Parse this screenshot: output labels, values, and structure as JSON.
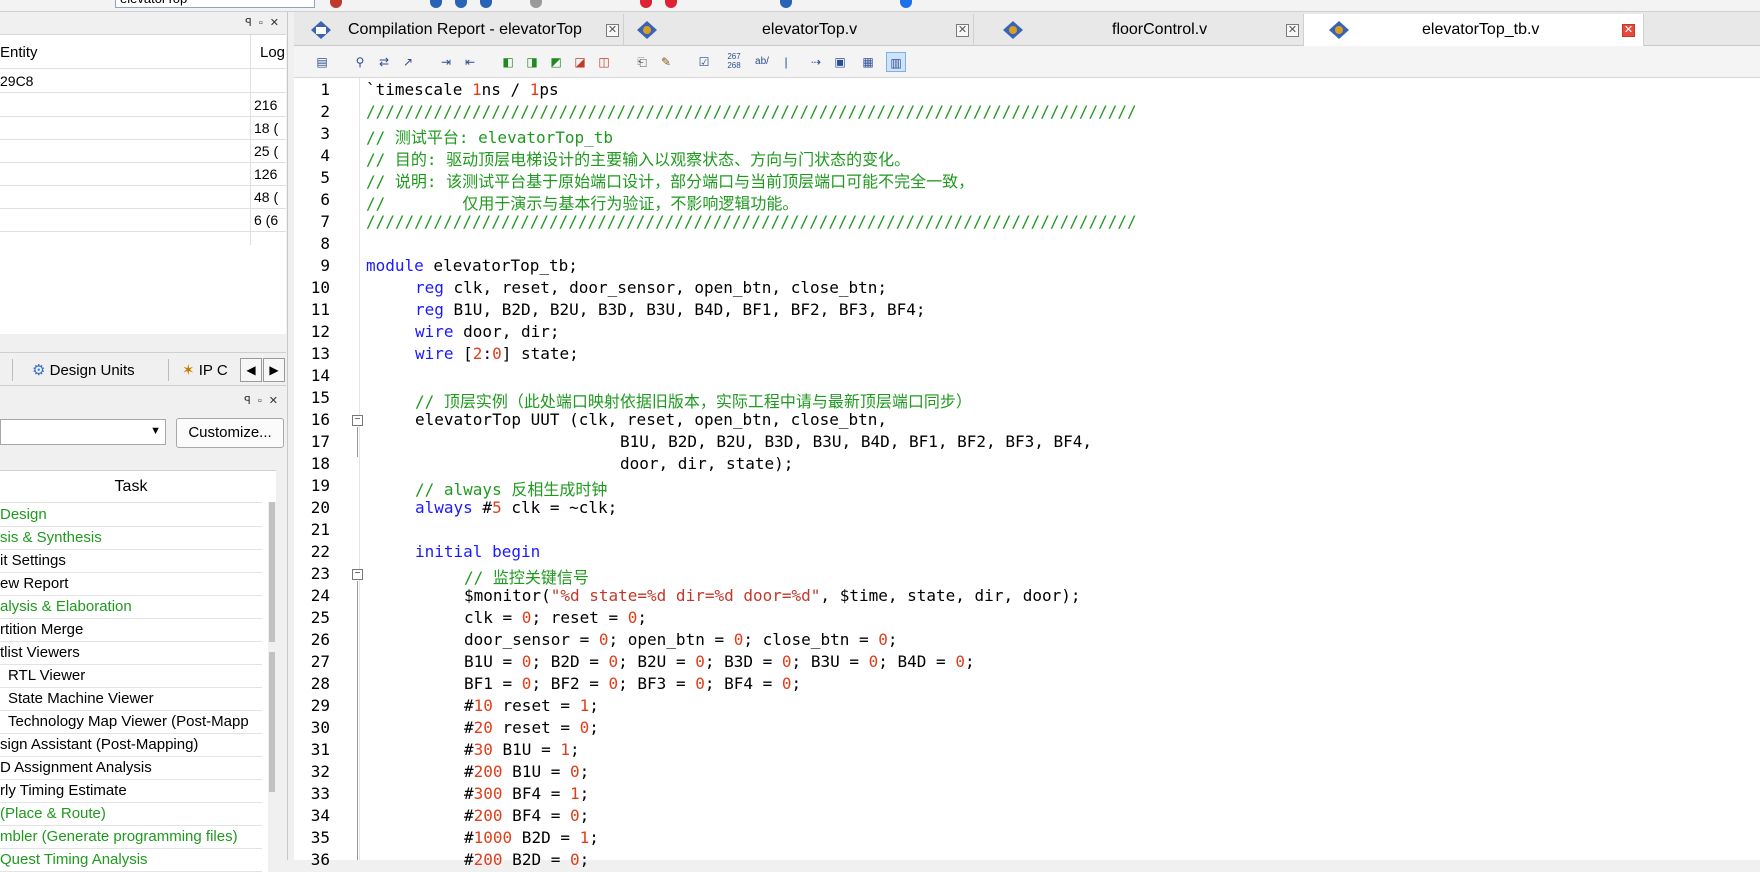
{
  "toolbar": {
    "search_value": "elevatorTop"
  },
  "entity_panel": {
    "col_entity": "Entity",
    "col_logic": "Log",
    "device": "29C8",
    "rows": [
      "216",
      "18 (",
      "25 (",
      "126",
      "48 (",
      "6 (6"
    ]
  },
  "left_tabs": {
    "design_units": "Design Units",
    "ip": "IP C"
  },
  "tasks": {
    "customize_label": "Customize...",
    "header": "Task",
    "items": [
      "Design",
      "sis & Synthesis",
      "it Settings",
      "ew Report",
      "alysis & Elaboration",
      "rtition Merge",
      "tlist Viewers",
      "RTL Viewer",
      "State Machine Viewer",
      "Technology Map Viewer (Post-Mapp",
      "sign Assistant (Post-Mapping)",
      "D Assignment Analysis",
      "rly Timing Estimate",
      "(Place & Route)",
      "mbler (Generate programming files)",
      "Quest Timing Analysis"
    ]
  },
  "tabs": [
    {
      "label": "Compilation Report - elevatorTop"
    },
    {
      "label": "elevatorTop.v"
    },
    {
      "label": "floorControl.v"
    },
    {
      "label": "elevatorTop_tb.v"
    }
  ],
  "editor_toolbar": {
    "line_counter": "267\n268",
    "ab_label": "ab/"
  },
  "colors": {
    "keyword": "#1a1aff",
    "number": "#e03e1a",
    "comment": "#1f9a1f",
    "tab_close_active": "#e64a3b"
  },
  "code": {
    "l1a": "`timescale ",
    "l1b": "1",
    "l1c": "ns / ",
    "l1d": "1",
    "l1e": "ps",
    "l2": "////////////////////////////////////////////////////////////////////////////////",
    "l3": "// 测试平台: elevatorTop_tb",
    "l4": "// 目的: 驱动顶层电梯设计的主要输入以观察状态、方向与门状态的变化。",
    "l5": "// 说明: 该测试平台基于原始端口设计，部分端口与当前顶层端口可能不完全一致，",
    "l6": "//        仅用于演示与基本行为验证，不影响逻辑功能。",
    "l7": "////////////////////////////////////////////////////////////////////////////////",
    "l9a": "module",
    "l9b": " elevatorTop_tb;",
    "l10a": "reg",
    "l10b": " clk, reset, door_sensor, open_btn, close_btn;",
    "l11a": "reg",
    "l11b": " B1U, B2D, B2U, B3D, B3U, B4D, BF1, BF2, BF3, BF4;",
    "l12a": "wire",
    "l12b": " door, dir;",
    "l13a": "wire",
    "l13b": " [",
    "l13c": "2",
    "l13d": ":",
    "l13e": "0",
    "l13f": "] state;",
    "l15": "// 顶层实例（此处端口映射依据旧版本，实际工程中请与最新顶层端口同步）",
    "l16": "elevatorTop UUT (clk, reset, open_btn, close_btn,",
    "l17": "B1U, B2D, B2U, B3D, B3U, B4D, BF1, BF2, BF3, BF4,",
    "l18": "door, dir, state);",
    "l19": "// always 反相生成时钟",
    "l20a": "always",
    "l20b": " #",
    "l20c": "5",
    "l20d": " clk = ~clk;",
    "l22a": "initial",
    "l22b": " ",
    "l22c": "begin",
    "l23": "// 监控关键信号",
    "l24a": "$monitor(",
    "l24b": "\"%d state=%d dir=%d door=%d\"",
    "l24c": ", $time, state, dir, door);",
    "l25a": "clk = ",
    "l25b": "0",
    "l25c": "; reset = ",
    "l25d": "0",
    "l25e": ";",
    "l26a": "door_sensor = ",
    "l26b": "0",
    "l26c": "; open_btn = ",
    "l26d": "0",
    "l26e": "; close_btn = ",
    "l26f": "0",
    "l26g": ";",
    "l27a": "B1U = ",
    "l27b": "0",
    "l27c": "; B2D = ",
    "l27d": "0",
    "l27e": "; B2U = ",
    "l27f": "0",
    "l27g": "; B3D = ",
    "l27h": "0",
    "l27i": "; B3U = ",
    "l27j": "0",
    "l27k": "; B4D = ",
    "l27l": "0",
    "l27m": ";",
    "l28a": "BF1 = ",
    "l28b": "0",
    "l28c": "; BF2 = ",
    "l28d": "0",
    "l28e": "; BF3 = ",
    "l28f": "0",
    "l28g": "; BF4 = ",
    "l28h": "0",
    "l28i": ";",
    "l29a": "#",
    "l29b": "10",
    "l29c": " reset = ",
    "l29d": "1",
    "l29e": ";",
    "l30a": "#",
    "l30b": "20",
    "l30c": " reset = ",
    "l30d": "0",
    "l30e": ";",
    "l31a": "#",
    "l31b": "30",
    "l31c": " B1U = ",
    "l31d": "1",
    "l31e": ";",
    "l32a": "#",
    "l32b": "200",
    "l32c": " B1U = ",
    "l32d": "0",
    "l32e": ";",
    "l33a": "#",
    "l33b": "300",
    "l33c": " BF4 = ",
    "l33d": "1",
    "l33e": ";",
    "l34a": "#",
    "l34b": "200",
    "l34c": " BF4 = ",
    "l34d": "0",
    "l34e": ";",
    "l35a": "#",
    "l35b": "1000",
    "l35c": " B2D = ",
    "l35d": "1",
    "l35e": ";",
    "l36a": "#",
    "l36b": "200",
    "l36c": " B2D = ",
    "l36d": "0",
    "l36e": ";"
  },
  "line_numbers": [
    "1",
    "2",
    "3",
    "4",
    "5",
    "6",
    "7",
    "8",
    "9",
    "10",
    "11",
    "12",
    "13",
    "14",
    "15",
    "16",
    "17",
    "18",
    "19",
    "20",
    "21",
    "22",
    "23",
    "24",
    "25",
    "26",
    "27",
    "28",
    "29",
    "30",
    "31",
    "32",
    "33",
    "34",
    "35",
    "36"
  ]
}
